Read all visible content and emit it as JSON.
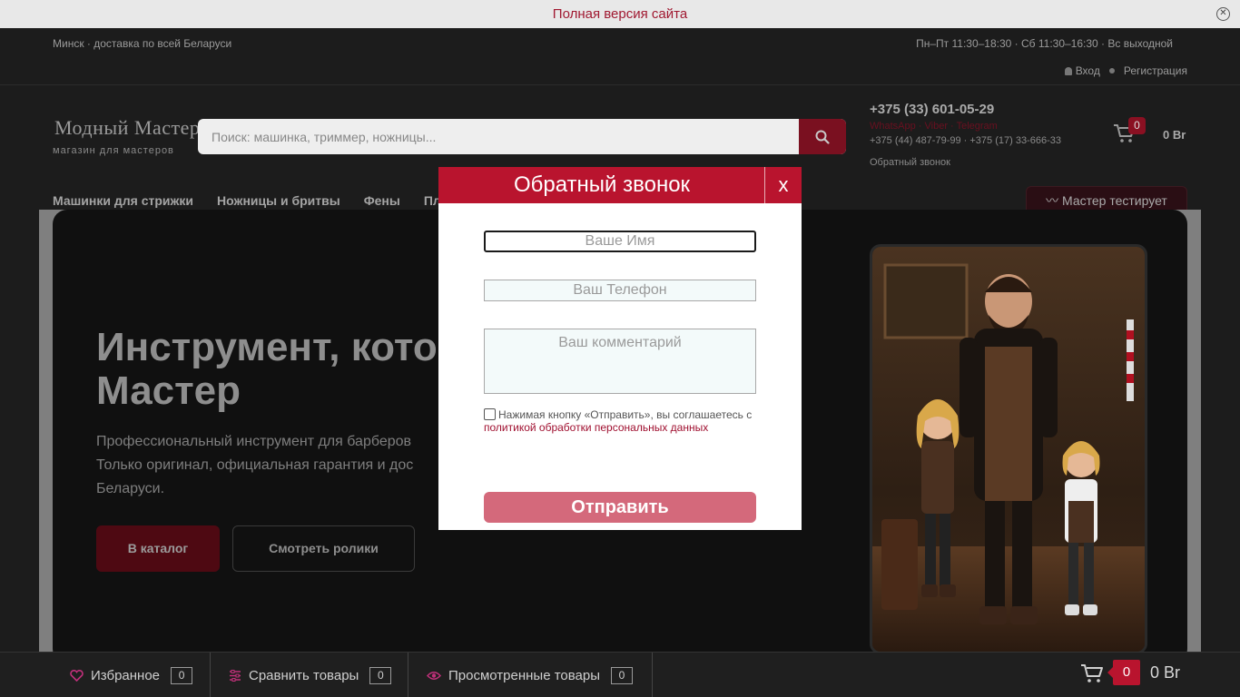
{
  "topbar": {
    "full_version": "Полная версия сайта",
    "close": "✕"
  },
  "info": {
    "location": "Минск · доставка по всей Беларуси",
    "hours": "Пн–Пт 11:30–18:30 · Сб 11:30–16:30 · Вс выходной",
    "login": "Вход",
    "register": "Регистрация"
  },
  "header": {
    "logo_title": "Модный Мастер",
    "logo_subtitle": "магазин для мастеров",
    "search_placeholder": "Поиск: машинка, триммер, ножницы...",
    "phone_main": "+375 (33) 601-05-29",
    "messengers": "WhatsApp · Viber · Telegram",
    "phones_extra": "+375 (44) 487-79-99 · +375 (17) 33-666-33",
    "callback": "Обратный звонок",
    "cart_count": "0",
    "cart_total": "0 Br"
  },
  "nav": {
    "items": [
      "Машинки для стрижки",
      "Ножницы и бритвы",
      "Фены",
      "Плойки"
    ],
    "master_button": "Мастер тестирует"
  },
  "hero": {
    "title": "Инструмент, кото Мастер",
    "text": "Профессиональный инструмент для барберов Только оригинал, официальная гарантия и дос Беларуси.",
    "catalog_button": "В каталог",
    "videos_button": "Смотреть ролики"
  },
  "modal": {
    "title": "Обратный звонок",
    "close": "x",
    "name_placeholder": "Ваше Имя",
    "phone_placeholder": "Ваш Телефон",
    "comment_placeholder": "Ваш комментарий",
    "consent_text": "Нажимая кнопку «Отправить», вы соглашаетесь с",
    "policy_link": "политикой обработки персональных данных",
    "submit": "Отправить"
  },
  "bottombar": {
    "favorites_label": "Избранное",
    "favorites_count": "0",
    "compare_label": "Сравнить товары",
    "compare_count": "0",
    "viewed_label": "Просмотренные товары",
    "viewed_count": "0",
    "cart_count": "0",
    "cart_total": "0 Br"
  },
  "colors": {
    "accent": "#b9142e",
    "submit": "#d4697b",
    "dark_bg": "#1c1c1c"
  }
}
